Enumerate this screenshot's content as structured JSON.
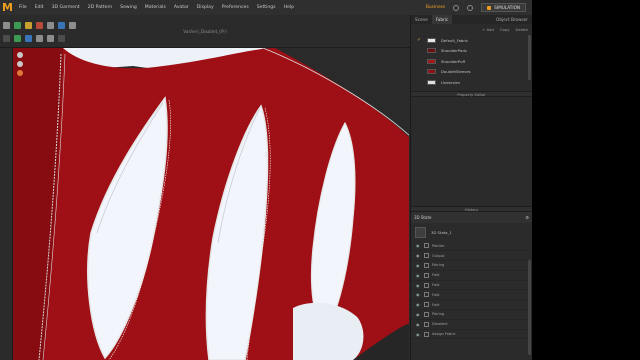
{
  "menubar": {
    "logo": "M",
    "items": [
      "File",
      "Edit",
      "3D Garment",
      "2D Pattern",
      "Sewing",
      "Materials",
      "Avatar",
      "Display",
      "Preferences",
      "Settings",
      "Help"
    ],
    "badge": "Business",
    "simulation": "SIMULATION"
  },
  "toolbar": {
    "document_title": "Vasheri_Doublet_(Pr)"
  },
  "panel": {
    "tabs": [
      "Scene",
      "Fabric"
    ],
    "active_tab": "Fabric",
    "object_browser": "Object Browser",
    "actions": [
      "+ Add",
      "Copy",
      "Delete"
    ],
    "fabrics": [
      {
        "name": "Default_Fabric",
        "color": "#e8e8e8",
        "checked": true
      },
      {
        "name": "ShoulderPads",
        "color": "#6a0d10",
        "checked": false
      },
      {
        "name": "ShoulderPuff",
        "color": "#a0171c",
        "checked": false
      },
      {
        "name": "DoubletSleeves",
        "color": "#8e1216",
        "checked": false
      },
      {
        "name": "Underslev",
        "color": "#dedede",
        "checked": false
      }
    ],
    "property_editor": "Property Editor",
    "history": "History",
    "state_title": "3D State",
    "state_item": "3D State_1",
    "layers": [
      "Pointer",
      "Output",
      "Pairing",
      "Fold",
      "Fold",
      "Fold",
      "Fold",
      "Pairing",
      "Deselect",
      "Assign Fabric"
    ]
  },
  "colors": {
    "fabric_red": "#9e1016",
    "lining_white": "#f2f5fb",
    "accent": "#f0a020"
  }
}
